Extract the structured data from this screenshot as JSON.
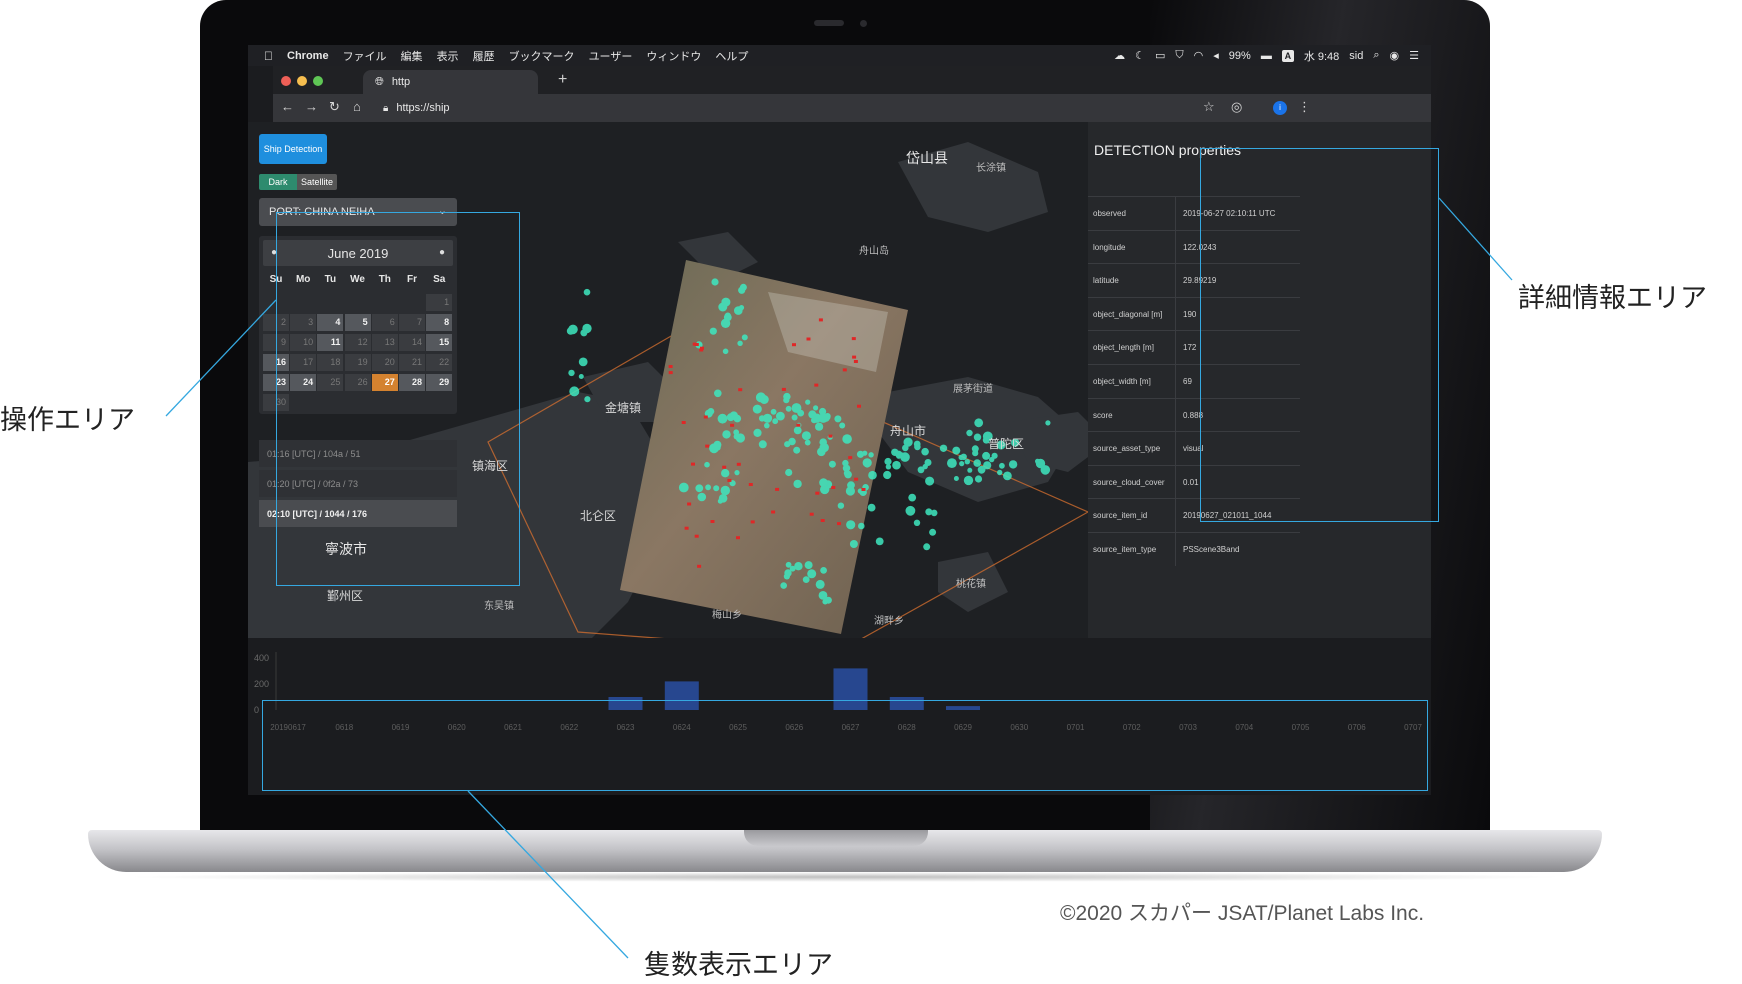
{
  "menubar": {
    "app": "Chrome",
    "items": [
      "ファイル",
      "編集",
      "表示",
      "履歴",
      "ブックマーク",
      "ユーザー",
      "ウィンドウ",
      "ヘルプ"
    ],
    "battery": "99%",
    "input": "A",
    "clock": "水 9:48",
    "user": "sid"
  },
  "browser": {
    "tab_title": "http",
    "url": "https://ship"
  },
  "app": {
    "ship_button": "Ship Detection",
    "basemap": {
      "dark": "Dark",
      "satellite": "Satellite"
    },
    "port_select": "PORT: CHINA NEIHA",
    "calendar": {
      "month": "June 2019",
      "weekdays": [
        "Su",
        "Mo",
        "Tu",
        "We",
        "Th",
        "Fr",
        "Sa"
      ],
      "available_days": [
        4,
        5,
        8,
        11,
        15,
        16,
        23,
        24,
        28,
        29
      ],
      "selected_day": 27
    },
    "observations": [
      "01:16 [UTC] / 104a / 51",
      "01:20 [UTC] / 0f2a / 73",
      "02:10 [UTC] / 1044 / 176"
    ]
  },
  "map": {
    "labels": {
      "daishan": "岱山县",
      "changtu": "长涂镇",
      "zhoushan_island": "舟山岛",
      "jintang": "金塘镇",
      "zhenhai": "镇海区",
      "beilun": "北仑区",
      "ningbo": "寧波市",
      "yinzhou": "鄞州区",
      "dongwu": "东吴镇",
      "meishan": "梅山乡",
      "zhoushan_city": "舟山市",
      "putuo": "普陀区",
      "zhanmao": "展茅街道",
      "taohua": "桃花镇",
      "hupan": "湖畔乡"
    }
  },
  "detail": {
    "title": "DETECTION properties",
    "rows": [
      {
        "key": "observed",
        "value": "2019-06-27 02:10:11 UTC"
      },
      {
        "key": "longitude",
        "value": "122.0243"
      },
      {
        "key": "latitude",
        "value": "29.89219"
      },
      {
        "key": "object_diagonal [m]",
        "value": "190"
      },
      {
        "key": "object_length [m]",
        "value": "172"
      },
      {
        "key": "object_width [m]",
        "value": "69"
      },
      {
        "key": "score",
        "value": "0.888"
      },
      {
        "key": "source_asset_type",
        "value": "visual"
      },
      {
        "key": "source_cloud_cover",
        "value": "0.01"
      },
      {
        "key": "source_item_id",
        "value": "20190627_021011_1044"
      },
      {
        "key": "source_item_type",
        "value": "PSScene3Band"
      }
    ]
  },
  "chart_data": {
    "type": "bar",
    "yticks": [
      "400",
      "200",
      "0"
    ],
    "ylim": [
      0,
      400
    ],
    "categories": [
      "20190617",
      "0618",
      "0619",
      "0620",
      "0621",
      "0622",
      "0623",
      "0624",
      "0625",
      "0626",
      "0627",
      "0628",
      "0629",
      "0630",
      "0701",
      "0702",
      "0703",
      "0704",
      "0705",
      "0706",
      "0707"
    ],
    "values": [
      0,
      0,
      0,
      0,
      0,
      0,
      100,
      220,
      0,
      0,
      320,
      100,
      30,
      0,
      0,
      0,
      0,
      0,
      0,
      0,
      0
    ]
  },
  "annotations": {
    "control_area": "操作エリア",
    "detail_area": "詳細情報エリア",
    "count_area": "隻数表示エリア",
    "copyright": "©2020 スカパー JSAT/Planet Labs Inc."
  },
  "colors": {
    "callout": "#35a8e0",
    "ship_button": "#1f8fde",
    "selected_day": "#d4822f",
    "detections": "#3ee8c0",
    "bars": "#27478f"
  }
}
